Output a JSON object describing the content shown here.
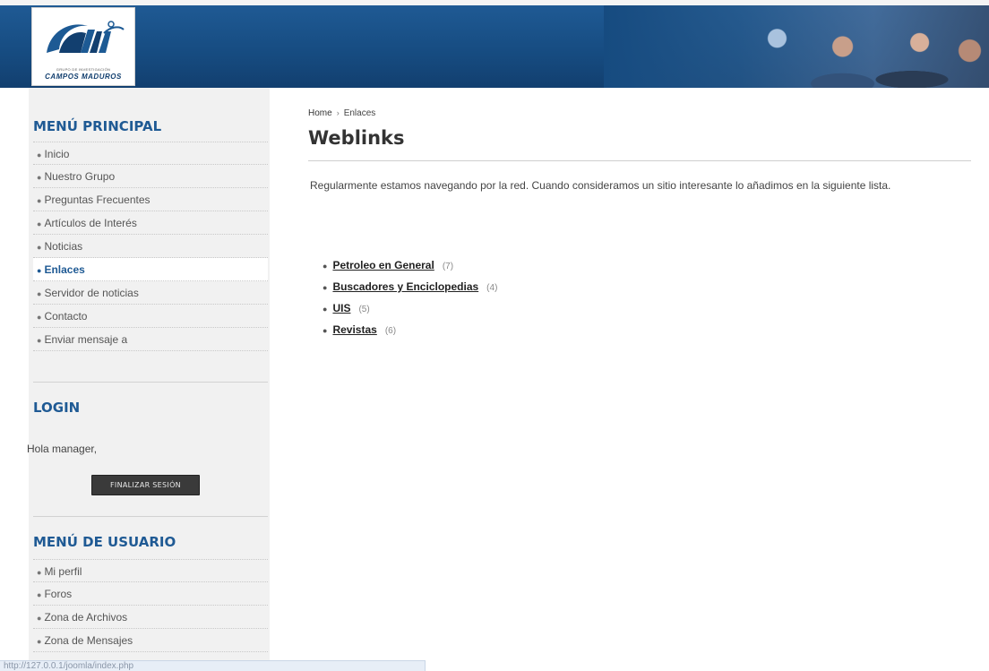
{
  "header": {
    "logo_caption_small": "GRUPO DE INVESTIGACIÓN",
    "logo_caption": "CAMPOS MADUROS"
  },
  "sidebar": {
    "main_menu": {
      "title": "MENÚ PRINCIPAL",
      "items": [
        {
          "label": "Inicio",
          "active": false
        },
        {
          "label": "Nuestro Grupo",
          "active": false
        },
        {
          "label": "Preguntas Frecuentes",
          "active": false
        },
        {
          "label": "Artículos de Interés",
          "active": false
        },
        {
          "label": "Noticias",
          "active": false
        },
        {
          "label": "Enlaces",
          "active": true
        },
        {
          "label": "Servidor de noticias",
          "active": false
        },
        {
          "label": "Contacto",
          "active": false
        },
        {
          "label": "Enviar mensaje a",
          "active": false
        }
      ]
    },
    "login": {
      "title": "LOGIN",
      "greeting": "Hola manager,",
      "logout_label": "FINALIZAR SESIÓN"
    },
    "user_menu": {
      "title": "MENÚ DE USUARIO",
      "items": [
        {
          "label": "Mi perfil"
        },
        {
          "label": "Foros"
        },
        {
          "label": "Zona de Archivos"
        },
        {
          "label": "Zona de Mensajes"
        }
      ]
    }
  },
  "main": {
    "breadcrumb": {
      "home": "Home",
      "separator": "›",
      "current": "Enlaces"
    },
    "title": "Weblinks",
    "intro": "Regularmente estamos navegando por la red. Cuando consideramos un sitio interesante lo añadimos en la siguiente lista.",
    "categories": [
      {
        "label": "Petroleo en General",
        "count": "(7)"
      },
      {
        "label": "Buscadores y Enciclopedias",
        "count": "(4)"
      },
      {
        "label": "UIS",
        "count": "(5)"
      },
      {
        "label": "Revistas",
        "count": "(6)"
      }
    ]
  },
  "status_bar": {
    "text": "http://127.0.0.1/joomla/index.php"
  },
  "colors": {
    "brand_blue": "#1f5a94",
    "sidebar_bg": "#f1f1f1",
    "button_bg": "#3a3a3a"
  }
}
